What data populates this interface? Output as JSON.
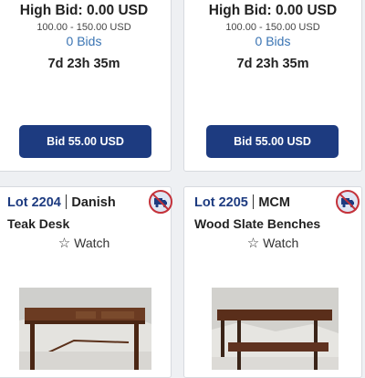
{
  "cards_top": [
    {
      "high_bid": "High Bid: 0.00 USD",
      "range": "100.00 - 150.00 USD",
      "bids": "0 Bids",
      "time_left": "7d 23h 35m",
      "bid_button": "Bid 55.00 USD"
    },
    {
      "high_bid": "High Bid: 0.00 USD",
      "range": "100.00 - 150.00 USD",
      "bids": "0 Bids",
      "time_left": "7d 23h 35m",
      "bid_button": "Bid 55.00 USD"
    }
  ],
  "cards_bottom": [
    {
      "lot": "Lot 2204",
      "title_part1": "Danish",
      "title_part2": "Teak Desk",
      "watch": "Watch",
      "icons": [
        "no-shipping-icon",
        "star-outline-icon"
      ]
    },
    {
      "lot": "Lot 2205",
      "title_part1": "MCM",
      "title_part2": "Wood Slate Benches",
      "watch": "Watch",
      "icons": [
        "no-shipping-icon",
        "star-outline-icon"
      ]
    }
  ],
  "colors": {
    "primary": "#1d3b80",
    "link": "#3a74b3",
    "no_ship_red": "#c4323a"
  }
}
